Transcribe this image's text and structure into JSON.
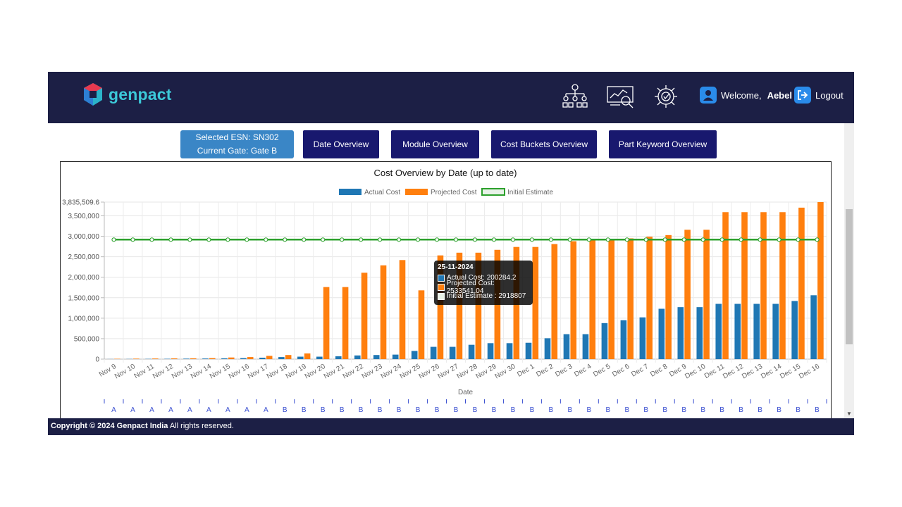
{
  "header": {
    "brand": "genpact",
    "welcome_label": "Welcome,",
    "username": "Aebel",
    "logout_label": "Logout",
    "icons": [
      "org-hierarchy-icon",
      "analytics-dashboard-icon",
      "settings-gear-icon"
    ]
  },
  "toolbar": {
    "esn_label": "Selected ESN: SN302",
    "gate_label": "Current Gate: Gate B",
    "date_overview": "Date Overview",
    "module_overview": "Module Overview",
    "cost_buckets_overview": "Cost Buckets Overview",
    "part_keyword_overview": "Part Keyword Overview"
  },
  "tooltip": {
    "title": "25-11-2024",
    "actual": "Actual Cost: 200284.2",
    "projected": "Projected Cost: 2533541.04",
    "initial": "Initial Estimate : 2918807"
  },
  "footer": {
    "copyright_bold": "Copyright © 2024 Genpact India",
    "copyright_rest": " All rights reserved."
  },
  "colors": {
    "header_bg": "#1c1f45",
    "actual": "#1f77b4",
    "projected": "#ff7f0e",
    "estimate": "#2ca02c",
    "button_bg": "#18186e",
    "esn_bg": "#3a86c6"
  },
  "chart_data": {
    "type": "bar",
    "title": "Cost Overview by Date (up to date)",
    "xlabel": "Date",
    "ylabel": "",
    "ylim": [
      0,
      3835509.6
    ],
    "yticks": [
      "0",
      "500,000",
      "1,000,000",
      "1,500,000",
      "2,000,000",
      "2,500,000",
      "3,000,000",
      "3,500,000",
      "3,835,509.6"
    ],
    "legend_position": "top-center",
    "grid": true,
    "categories": [
      "Nov 9",
      "Nov 10",
      "Nov 11",
      "Nov 12",
      "Nov 13",
      "Nov 14",
      "Nov 15",
      "Nov 16",
      "Nov 17",
      "Nov 18",
      "Nov 19",
      "Nov 20",
      "Nov 21",
      "Nov 22",
      "Nov 23",
      "Nov 24",
      "Nov 25",
      "Nov 26",
      "Nov 27",
      "Nov 28",
      "Nov 29",
      "Nov 30",
      "Dec 1",
      "Dec 2",
      "Dec 3",
      "Dec 4",
      "Dec 5",
      "Dec 6",
      "Dec 7",
      "Dec 8",
      "Dec 9",
      "Dec 10",
      "Dec 11",
      "Dec 12",
      "Dec 13",
      "Dec 14",
      "Dec 15",
      "Dec 16"
    ],
    "gates": [
      "A",
      "A",
      "A",
      "A",
      "A",
      "A",
      "A",
      "A",
      "A",
      "B",
      "B",
      "B",
      "B",
      "B",
      "B",
      "B",
      "B",
      "B",
      "B",
      "B",
      "B",
      "B",
      "B",
      "B",
      "B",
      "B",
      "B",
      "B",
      "B",
      "B",
      "B",
      "B",
      "B",
      "B",
      "B",
      "B",
      "B",
      "B"
    ],
    "series": [
      {
        "name": "Actual Cost",
        "color": "#1f77b4",
        "values": [
          2000,
          4000,
          6000,
          8000,
          12000,
          15000,
          20000,
          25000,
          35000,
          50000,
          60000,
          60000,
          70000,
          90000,
          100000,
          110000,
          200284.2,
          300000,
          300000,
          350000,
          390000,
          390000,
          400000,
          510000,
          610000,
          610000,
          880000,
          950000,
          1020000,
          1230000,
          1270000,
          1270000,
          1350000,
          1350000,
          1350000,
          1350000,
          1420000,
          1560000
        ]
      },
      {
        "name": "Projected Cost",
        "color": "#ff7f0e",
        "values": [
          8000,
          12000,
          15000,
          18000,
          20000,
          25000,
          40000,
          50000,
          80000,
          100000,
          140000,
          1760000,
          1760000,
          2110000,
          2290000,
          2420000,
          1680000,
          2533541.04,
          2600000,
          2600000,
          2670000,
          2740000,
          2740000,
          2810000,
          2880000,
          2920000,
          2920000,
          2950000,
          2990000,
          3030000,
          3160000,
          3160000,
          3590000,
          3590000,
          3590000,
          3590000,
          3700000,
          3835509.6
        ]
      },
      {
        "name": "Initial Estimate",
        "color": "#2ca02c",
        "line": true,
        "values": [
          2918807,
          2918807,
          2918807,
          2918807,
          2918807,
          2918807,
          2918807,
          2918807,
          2918807,
          2918807,
          2918807,
          2918807,
          2918807,
          2918807,
          2918807,
          2918807,
          2918807,
          2918807,
          2918807,
          2918807,
          2918807,
          2918807,
          2918807,
          2918807,
          2918807,
          2918807,
          2918807,
          2918807,
          2918807,
          2918807,
          2918807,
          2918807,
          2918807,
          2918807,
          2918807,
          2918807,
          2918807,
          2918807
        ]
      }
    ]
  }
}
